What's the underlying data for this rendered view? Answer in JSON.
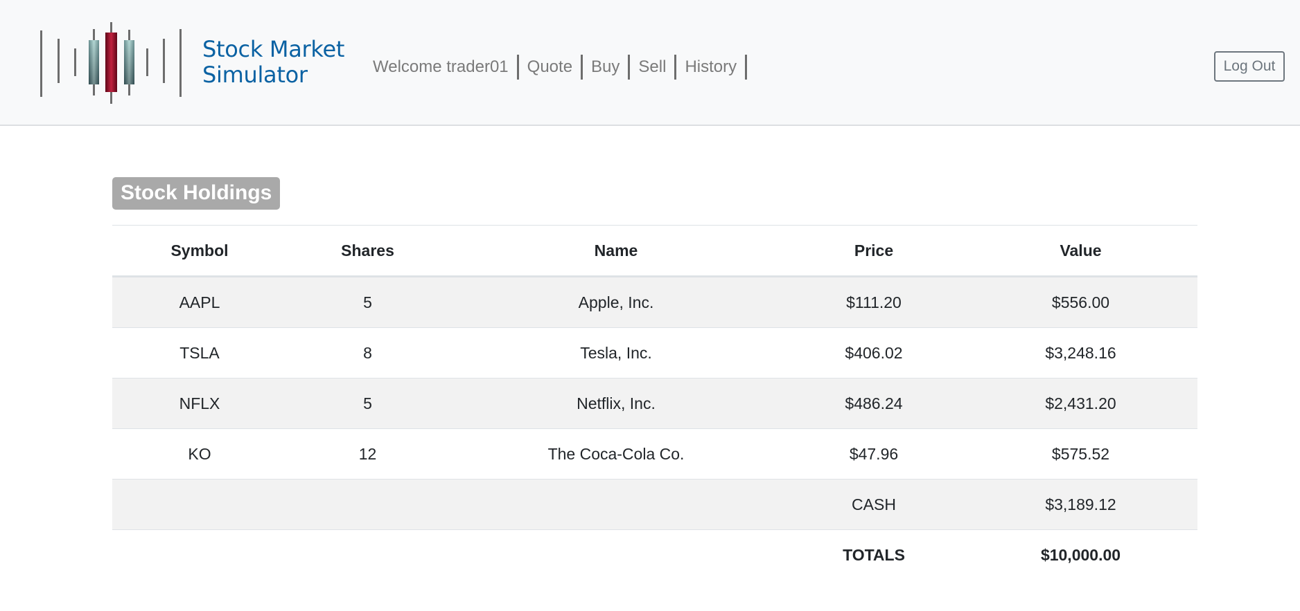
{
  "brand": {
    "line1": "Stock Market",
    "line2": "Simulator",
    "logo_icon": "candlestick-chart-icon",
    "colors": {
      "text": "#0b62a3",
      "bar": "#6d6d6d",
      "bearish_candle": "#8b0b24",
      "bullish_candle": "#3f6b70"
    }
  },
  "nav": {
    "welcome": "Welcome trader01",
    "items": [
      {
        "label": "Quote"
      },
      {
        "label": "Buy"
      },
      {
        "label": "Sell"
      },
      {
        "label": "History"
      }
    ]
  },
  "logout": {
    "label": "Log Out"
  },
  "holdings": {
    "title": "Stock Holdings",
    "columns": [
      "Symbol",
      "Shares",
      "Name",
      "Price",
      "Value"
    ],
    "rows": [
      [
        "AAPL",
        "5",
        "Apple, Inc.",
        "$111.20",
        "$556.00"
      ],
      [
        "TSLA",
        "8",
        "Tesla, Inc.",
        "$406.02",
        "$3,248.16"
      ],
      [
        "NFLX",
        "5",
        "Netflix, Inc.",
        "$486.24",
        "$2,431.20"
      ],
      [
        "KO",
        "12",
        "The Coca-Cola Co.",
        "$47.96",
        "$575.52"
      ]
    ],
    "cash": {
      "label": "CASH",
      "value": "$3,189.12"
    },
    "totals": {
      "label": "TOTALS",
      "value": "$10,000.00"
    }
  }
}
